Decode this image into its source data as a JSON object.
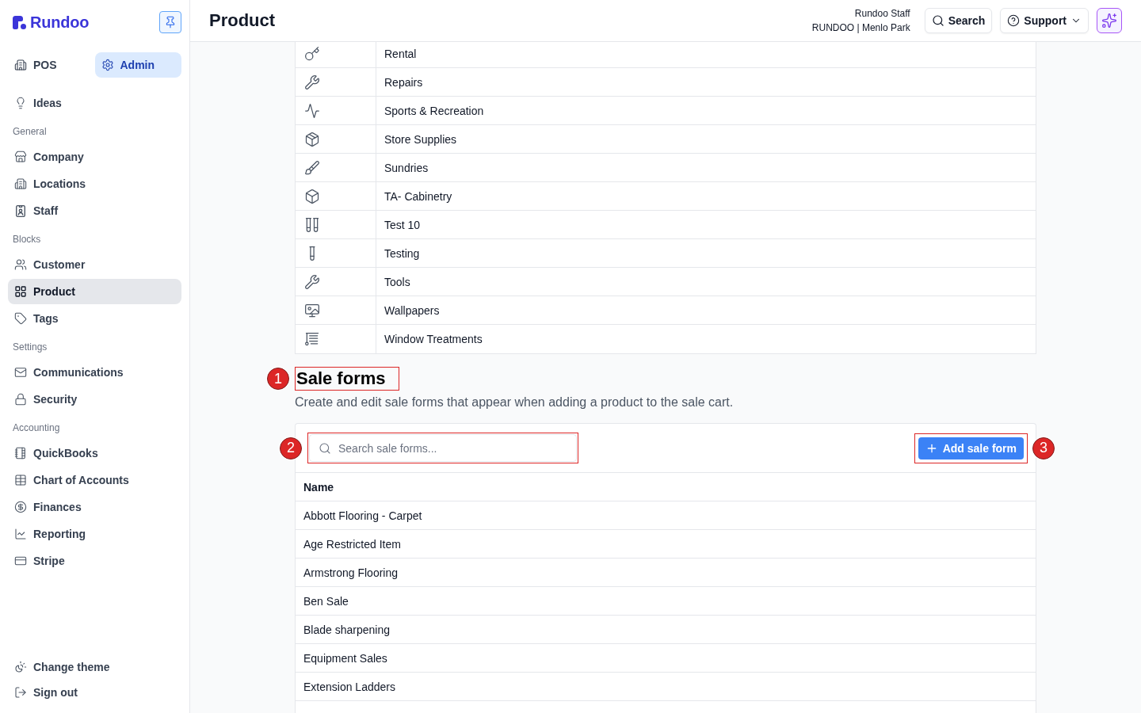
{
  "sidebar": {
    "brand": "Rundoo",
    "modes": [
      {
        "label": "POS",
        "selected": false
      },
      {
        "label": "Admin",
        "selected": true
      }
    ],
    "top_items": [
      {
        "label": "Ideas",
        "selected": false
      }
    ],
    "sections": [
      {
        "title": "General",
        "items": [
          {
            "label": "Company",
            "selected": false
          },
          {
            "label": "Locations",
            "selected": false
          },
          {
            "label": "Staff",
            "selected": false
          }
        ]
      },
      {
        "title": "Blocks",
        "items": [
          {
            "label": "Customer",
            "selected": false
          },
          {
            "label": "Product",
            "selected": true
          },
          {
            "label": "Tags",
            "selected": false
          }
        ]
      },
      {
        "title": "Settings",
        "items": [
          {
            "label": "Communications",
            "selected": false
          },
          {
            "label": "Security",
            "selected": false
          }
        ]
      },
      {
        "title": "Accounting",
        "items": [
          {
            "label": "QuickBooks",
            "selected": false
          },
          {
            "label": "Chart of Accounts",
            "selected": false
          },
          {
            "label": "Finances",
            "selected": false
          },
          {
            "label": "Reporting",
            "selected": false
          },
          {
            "label": "Stripe",
            "selected": false
          }
        ]
      }
    ],
    "footer_items": [
      {
        "label": "Change theme"
      },
      {
        "label": "Sign out"
      }
    ]
  },
  "header": {
    "title": "Product",
    "user_name": "Rundoo Staff",
    "user_location": "RUNDOO | Menlo Park",
    "search_button": "Search",
    "support_button": "Support"
  },
  "categories": [
    {
      "name": "Rental"
    },
    {
      "name": "Repairs"
    },
    {
      "name": "Sports & Recreation"
    },
    {
      "name": "Store Supplies"
    },
    {
      "name": "Sundries"
    },
    {
      "name": "TA- Cabinetry"
    },
    {
      "name": "Test 10"
    },
    {
      "name": "Testing"
    },
    {
      "name": "Tools"
    },
    {
      "name": "Wallpapers"
    },
    {
      "name": "Window Treatments"
    }
  ],
  "sale_forms": {
    "title": "Sale forms",
    "title_marker": "1",
    "description": "Create and edit sale forms that appear when adding a product to the sale cart.",
    "search": {
      "placeholder": "Search sale forms...",
      "marker": "2"
    },
    "add_button": {
      "label": "Add sale form",
      "marker": "3"
    },
    "columns": [
      "Name"
    ],
    "rows": [
      "Abbott Flooring - Carpet",
      "Age Restricted Item",
      "Armstrong Flooring",
      "Ben Sale",
      "Blade sharpening",
      "Equipment Sales",
      "Extension Ladders"
    ]
  }
}
